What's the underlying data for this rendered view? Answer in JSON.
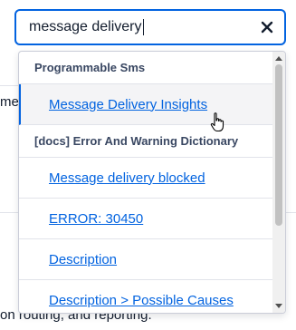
{
  "search": {
    "value": "message delivery",
    "clear_icon": "close-icon"
  },
  "background": {
    "left_fragment": "me",
    "bottom_text": "on routing, and reporting."
  },
  "dropdown": {
    "groups": [
      {
        "header": "Programmable Sms",
        "items": [
          {
            "label": "Message Delivery Insights",
            "hovered": true
          }
        ]
      },
      {
        "header": "[docs] Error And Warning Dictionary",
        "items": [
          {
            "label": "Message delivery blocked"
          },
          {
            "label": "ERROR: 30450"
          },
          {
            "label": "Description"
          },
          {
            "label": "Description > Possible Causes"
          }
        ]
      }
    ]
  },
  "colors": {
    "accent": "#0263e0",
    "link": "#0263e0",
    "text": "#121c2d",
    "header_text": "#394762",
    "hover_bg": "#f4f4f6"
  }
}
